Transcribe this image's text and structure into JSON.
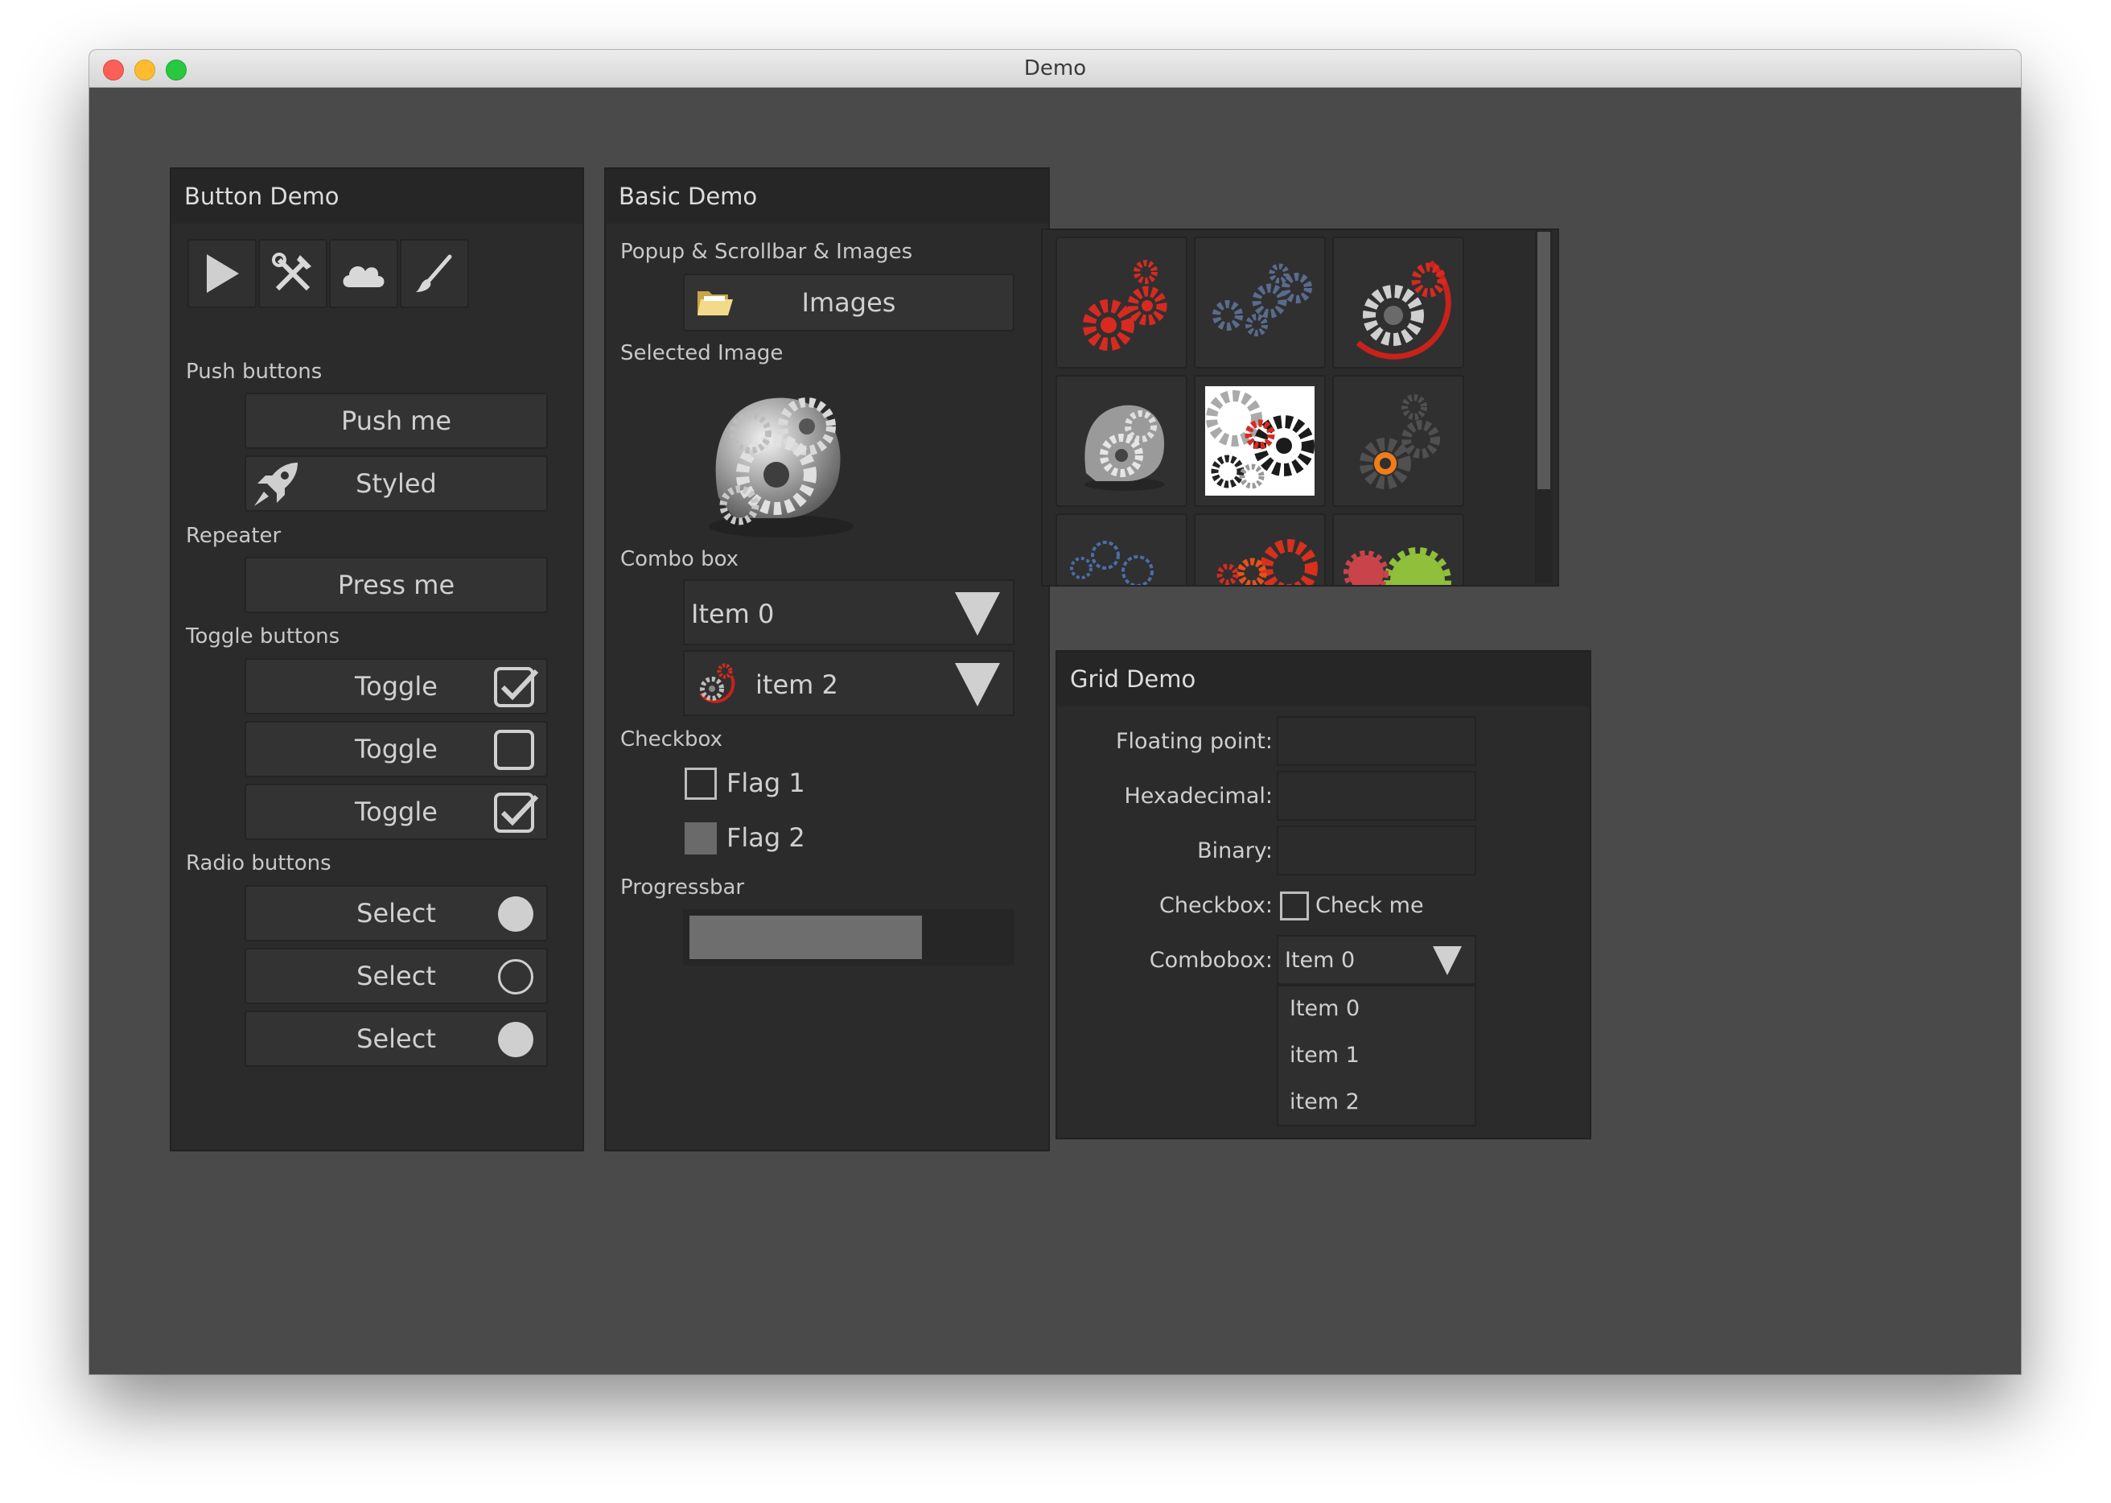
{
  "window": {
    "title": "Demo"
  },
  "button_demo": {
    "title": "Button Demo",
    "toolbar_icons": [
      "play-icon",
      "tools-icon",
      "cloud-icon",
      "brush-icon"
    ],
    "push_label": "Push buttons",
    "push_me": "Push me",
    "styled": "Styled",
    "repeater_label": "Repeater",
    "press_me": "Press me",
    "toggle_label": "Toggle buttons",
    "toggles": [
      {
        "label": "Toggle",
        "checked": true
      },
      {
        "label": "Toggle",
        "checked": false
      },
      {
        "label": "Toggle",
        "checked": true
      }
    ],
    "radio_label": "Radio buttons",
    "radios": [
      {
        "label": "Select",
        "selected": true
      },
      {
        "label": "Select",
        "selected": false
      },
      {
        "label": "Select",
        "selected": true
      }
    ]
  },
  "basic_demo": {
    "title": "Basic Demo",
    "popup_label": "Popup & Scrollbar & Images",
    "images_button": "Images",
    "selected_image_label": "Selected Image",
    "combo_label": "Combo box",
    "combo1_value": "Item 0",
    "combo2_value": "item 2",
    "checkbox_label": "Checkbox",
    "flag1": {
      "label": "Flag 1",
      "checked": false
    },
    "flag2": {
      "label": "Flag 2",
      "checked": true
    },
    "progress_label": "Progressbar",
    "progress": 0.73
  },
  "grid_demo": {
    "title": "Grid Demo",
    "floating_label": "Floating point:",
    "hex_label": "Hexadecimal:",
    "binary_label": "Binary:",
    "checkbox_label": "Checkbox:",
    "check_me": "Check me",
    "combobox_label": "Combobox:",
    "combobox_value": "Item 0",
    "dropdown_items": [
      "Item 0",
      "item 1",
      "item 2"
    ]
  },
  "colors": {
    "background": "#4a4a4a",
    "panel": "#2b2b2b",
    "control": "#333333",
    "text": "#d0d0d0",
    "gear_red": "#d82a20",
    "gear_blue": "#5a6b8c",
    "gear_orange": "#f07d18",
    "gear_green": "#8fbf3b"
  }
}
